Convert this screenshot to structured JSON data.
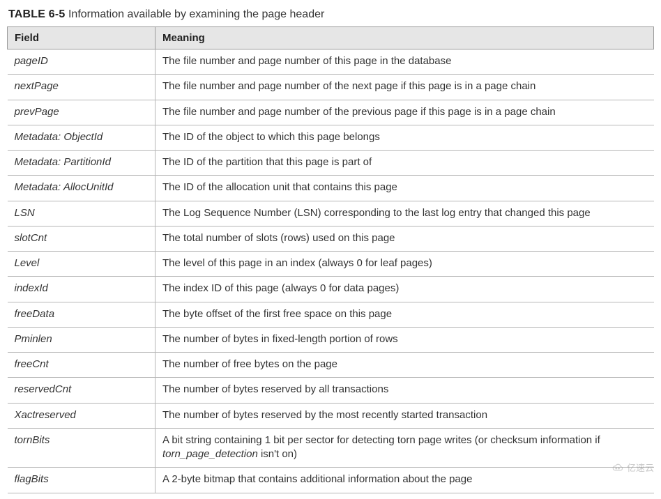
{
  "caption": {
    "label": "TABLE 6-5",
    "text": "Information available by examining the page header"
  },
  "headers": {
    "field": "Field",
    "meaning": "Meaning"
  },
  "rows": [
    {
      "field": "pageID",
      "meaning": "The file number and page number of this page in the database"
    },
    {
      "field": "nextPage",
      "meaning": "The file number and page number of the next page if this page is in a page chain"
    },
    {
      "field": "prevPage",
      "meaning": "The file number and page number of the previous page if this page is in a page chain"
    },
    {
      "field": "Metadata: ObjectId",
      "meaning": "The ID of the object to which this page belongs"
    },
    {
      "field": "Metadata: PartitionId",
      "meaning": "The ID of the partition that this page is part of"
    },
    {
      "field": "Metadata: AllocUnitId",
      "meaning": "The ID of the allocation unit that contains this page"
    },
    {
      "field": "LSN",
      "meaning": "The Log Sequence Number (LSN) corresponding to the last log entry that changed this page"
    },
    {
      "field": "slotCnt",
      "meaning": "The total number of slots (rows) used on this page"
    },
    {
      "field": "Level",
      "meaning": "The level of this page in an index (always 0 for leaf pages)"
    },
    {
      "field": "indexId",
      "meaning": "The index ID of this page (always 0 for data pages)"
    },
    {
      "field": "freeData",
      "meaning": "The byte offset of the first free space on this page"
    },
    {
      "field": "Pminlen",
      "meaning": "The number of bytes in fixed-length portion of rows"
    },
    {
      "field": "freeCnt",
      "meaning": "The number of free bytes on the page"
    },
    {
      "field": "reservedCnt",
      "meaning": "The number of bytes reserved by all transactions"
    },
    {
      "field": "Xactreserved",
      "meaning": "The number of bytes reserved by the most recently started transaction"
    },
    {
      "field": "tornBits",
      "meaning_pre": "A bit string containing 1 bit per sector for detecting torn page writes (or checksum information if ",
      "meaning_ital": "torn_page_detection",
      "meaning_post": " isn't on)"
    },
    {
      "field": "flagBits",
      "meaning": "A 2-byte bitmap that contains additional information about the page"
    }
  ],
  "watermark": {
    "text": "亿速云"
  }
}
